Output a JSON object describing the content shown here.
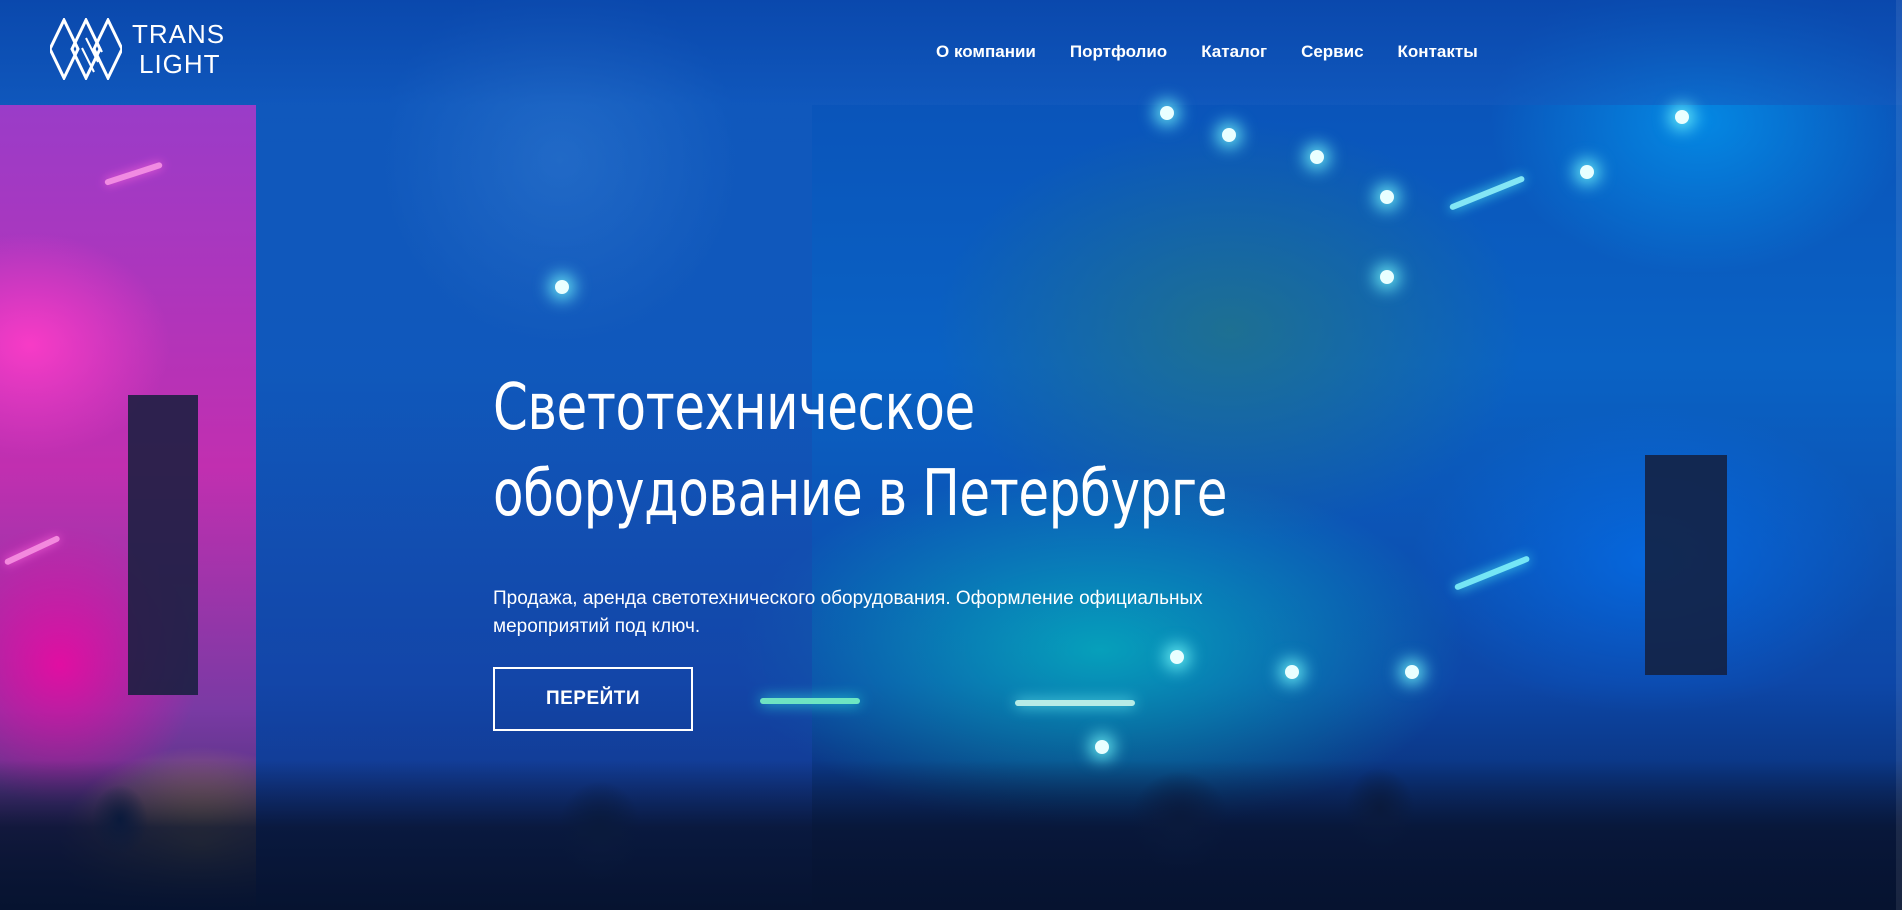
{
  "brand": {
    "name_line1": "TRANS",
    "name_line2": "LIGHT"
  },
  "nav": {
    "items": [
      {
        "label": "О компании"
      },
      {
        "label": "Портфолио"
      },
      {
        "label": "Каталог"
      },
      {
        "label": "Сервис"
      },
      {
        "label": "Контакты"
      }
    ]
  },
  "hero": {
    "title": "Светотехническое оборудование в Петербурге",
    "subtitle": "Продажа, аренда светотехнического оборудования. Оформление официальных мероприятий под ключ.",
    "cta_label": "ПЕРЕЙТИ",
    "background_image": "concert-stage-lights-confetti-crowd"
  },
  "colors": {
    "overlay_blue": "#1565c0",
    "text": "#ffffff"
  }
}
